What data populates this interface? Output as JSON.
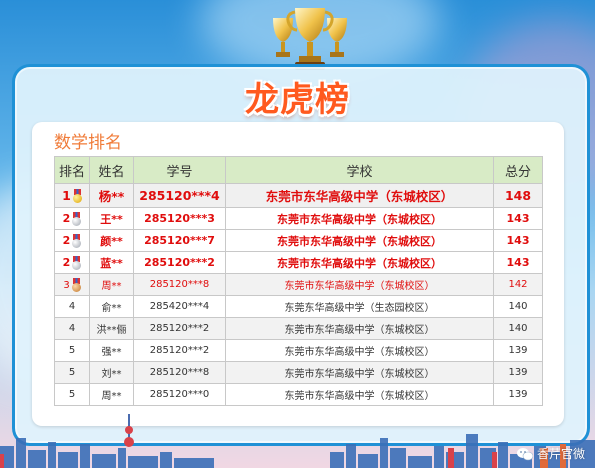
{
  "page": {
    "title": "龙虎榜",
    "section_title": "数学排名",
    "watermark": "香芹官微"
  },
  "table": {
    "headers": [
      "排名",
      "姓名",
      "学号",
      "学校",
      "总分"
    ],
    "rows": [
      {
        "rank": "1",
        "medal": "gold",
        "name": "杨**",
        "id": "285120***4",
        "school": "东莞市东华高级中学（东城校区）",
        "score": "148"
      },
      {
        "rank": "2",
        "medal": "silver",
        "name": "王**",
        "id": "285120***3",
        "school": "东莞市东华高级中学（东城校区）",
        "score": "143"
      },
      {
        "rank": "2",
        "medal": "silver",
        "name": "颜**",
        "id": "285120***7",
        "school": "东莞市东华高级中学（东城校区）",
        "score": "143"
      },
      {
        "rank": "2",
        "medal": "silver",
        "name": "蓝**",
        "id": "285120***2",
        "school": "东莞市东华高级中学（东城校区）",
        "score": "143"
      },
      {
        "rank": "3",
        "medal": "bronze",
        "name": "周**",
        "id": "285120***8",
        "school": "东莞市东华高级中学（东城校区）",
        "score": "142"
      },
      {
        "rank": "4",
        "name": "俞**",
        "id": "285420***4",
        "school": "东莞东华高级中学（生态园校区）",
        "score": "140"
      },
      {
        "rank": "4",
        "name": "洪**俪",
        "id": "285120***2",
        "school": "东莞市东华高级中学（东城校区）",
        "score": "140"
      },
      {
        "rank": "5",
        "name": "强**",
        "id": "285120***2",
        "school": "东莞市东华高级中学（东城校区）",
        "score": "139"
      },
      {
        "rank": "5",
        "name": "刘**",
        "id": "285120***8",
        "school": "东莞市东华高级中学（东城校区）",
        "score": "139"
      },
      {
        "rank": "5",
        "name": "周**",
        "id": "285120***0",
        "school": "东莞市东华高级中学（东城校区）",
        "score": "139"
      }
    ]
  },
  "colors": {
    "accent_red": "#e00d0d",
    "title_orange": "#ff5a1f",
    "header_green": "#d8ebc6",
    "panel_border": "#1f91d6"
  }
}
